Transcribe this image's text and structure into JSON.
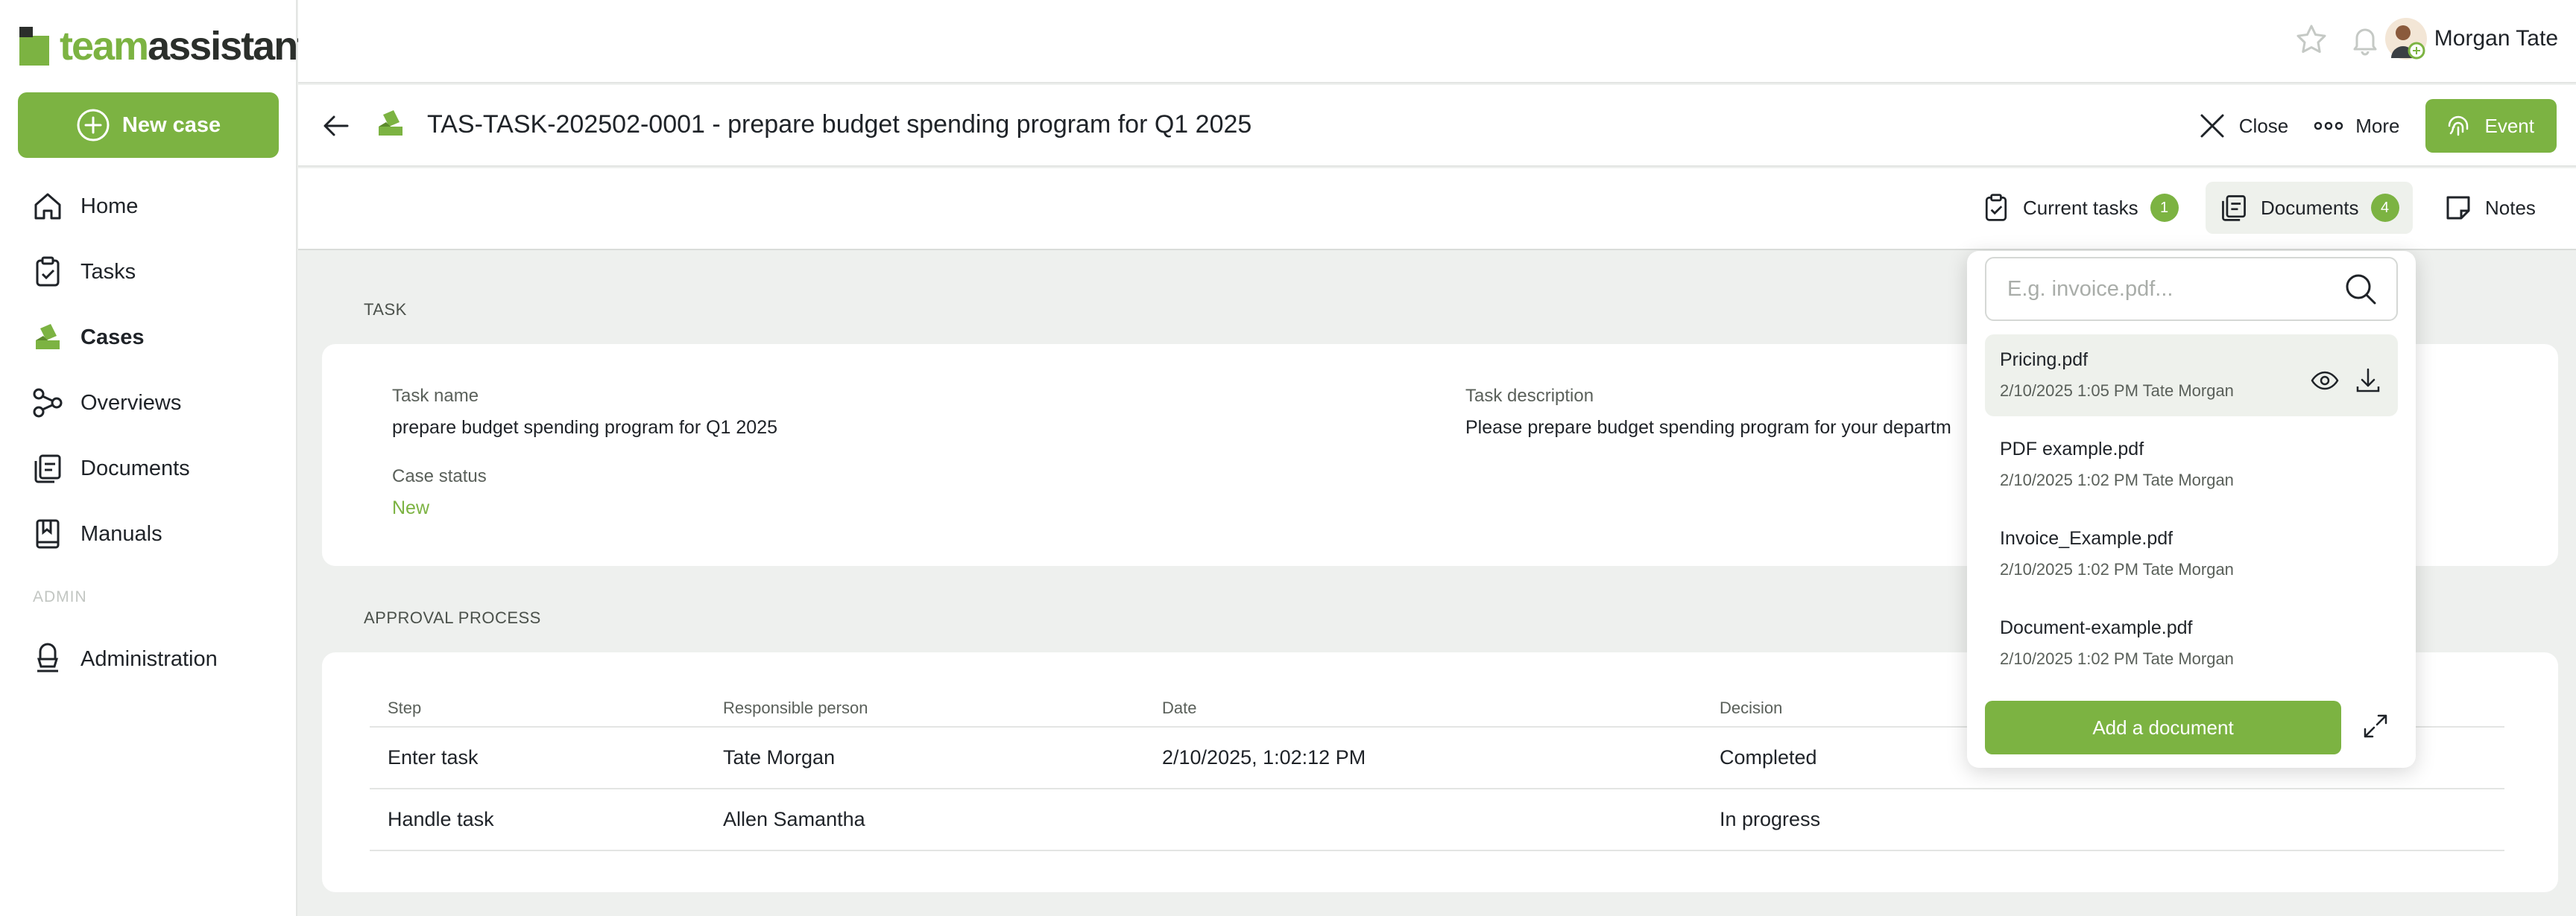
{
  "brand": {
    "logo_text_a": "team",
    "logo_text_b": "assistant",
    "accent": "#7cb342"
  },
  "sidebar": {
    "new_case_label": "New case",
    "items": [
      {
        "label": "Home",
        "icon": "home-icon"
      },
      {
        "label": "Tasks",
        "icon": "clipboard-check-icon"
      },
      {
        "label": "Cases",
        "icon": "cases-icon"
      },
      {
        "label": "Overviews",
        "icon": "nodes-icon"
      },
      {
        "label": "Documents",
        "icon": "documents-icon"
      },
      {
        "label": "Manuals",
        "icon": "book-icon"
      }
    ],
    "admin_section": "ADMIN",
    "admin_items": [
      {
        "label": "Administration",
        "icon": "admin-icon"
      }
    ]
  },
  "topbar": {
    "user_name": "Morgan Tate"
  },
  "titlebar": {
    "title": "TAS-TASK-202502-0001 - prepare budget spending program for Q1 2025",
    "close_label": "Close",
    "more_label": "More",
    "event_label": "Event"
  },
  "tabs": [
    {
      "label": "Current tasks",
      "badge": "1"
    },
    {
      "label": "Documents",
      "badge": "4"
    },
    {
      "label": "Notes"
    }
  ],
  "task": {
    "section_label": "TASK",
    "task_name_label": "Task name",
    "task_name": "prepare budget spending program for Q1 2025",
    "task_description_label": "Task description",
    "task_description": "Please prepare budget spending program for your departm",
    "case_status_label": "Case status",
    "case_status": "New"
  },
  "approval": {
    "section_label": "APPROVAL PROCESS",
    "columns": [
      "Step",
      "Responsible person",
      "Date",
      "Decision"
    ],
    "rows": [
      {
        "step": "Enter task",
        "person": "Tate Morgan",
        "date": "2/10/2025, 1:02:12 PM",
        "decision": "Completed"
      },
      {
        "step": "Handle task",
        "person": "Allen Samantha",
        "date": "",
        "decision": "In progress"
      }
    ]
  },
  "documents_panel": {
    "search_placeholder": "E.g. invoice.pdf...",
    "items": [
      {
        "name": "Pricing.pdf",
        "meta": "2/10/2025 1:05 PM Tate Morgan"
      },
      {
        "name": "PDF example.pdf",
        "meta": "2/10/2025 1:02 PM Tate Morgan"
      },
      {
        "name": "Invoice_Example.pdf",
        "meta": "2/10/2025 1:02 PM Tate Morgan"
      },
      {
        "name": "Document-example.pdf",
        "meta": "2/10/2025 1:02 PM Tate Morgan"
      }
    ],
    "add_label": "Add a document"
  }
}
